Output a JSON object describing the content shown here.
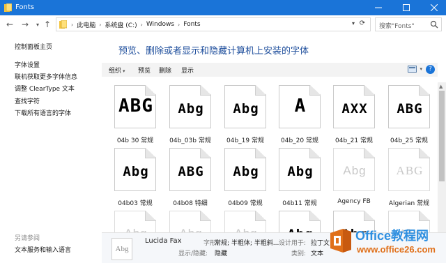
{
  "window": {
    "title": "Fonts",
    "colors": {
      "titlebar": "#1a74d8",
      "heading": "#1e4e9c",
      "toolbar": "#f3f3f3"
    }
  },
  "address": {
    "crumbs": [
      "此电脑",
      "系统盘 (C:)",
      "Windows",
      "Fonts"
    ],
    "search_placeholder": "搜索\"Fonts\""
  },
  "sidebar": {
    "top_link": "控制面板主页",
    "links": [
      "字体设置",
      "联机获取更多字体信息",
      "调整 ClearType 文本",
      "查找字符",
      "下载所有语言的字体"
    ],
    "see_also_heading": "另请参阅",
    "see_also_links": [
      "文本服务和输入语言"
    ]
  },
  "main": {
    "heading": "预览、删除或者显示和隐藏计算机上安装的字体",
    "toolbar": {
      "organize": "组织",
      "preview": "预览",
      "delete": "删除",
      "show": "显示"
    }
  },
  "fonts": [
    {
      "sample": "ABG",
      "label": "04b 30 常规",
      "style": "big"
    },
    {
      "sample": "Abg",
      "label": "04b_03b 常规",
      "style": "pixel"
    },
    {
      "sample": "Abg",
      "label": "04b_19 常规",
      "style": "pixel"
    },
    {
      "sample": "A",
      "label": "04b_20 常规",
      "style": "big"
    },
    {
      "sample": "AXX",
      "label": "04b_21 常规",
      "style": "pixel"
    },
    {
      "sample": "ABG",
      "label": "04b_25 常规",
      "style": "pixel"
    },
    {
      "sample": "Abg",
      "label": "04b03 常规",
      "style": "pixel"
    },
    {
      "sample": "ABG",
      "label": "04b08 特细",
      "style": "pixel"
    },
    {
      "sample": "Abg",
      "label": "04b09 常规",
      "style": "pixel"
    },
    {
      "sample": "Abg",
      "label": "04b11 常规",
      "style": "pixel"
    },
    {
      "sample": "Abg",
      "label": "Agency FB",
      "style": "light"
    },
    {
      "sample": "ABG",
      "label": "Algerian 常规",
      "style": "serif-light"
    },
    {
      "sample": "Abg",
      "label": "",
      "style": "light"
    },
    {
      "sample": "Abg",
      "label": "",
      "style": "light"
    },
    {
      "sample": "Abg",
      "label": "",
      "style": "light"
    },
    {
      "sample": "Abg",
      "label": "",
      "style": "pixel"
    },
    {
      "sample": "Abg",
      "label": "",
      "style": "pixel"
    },
    {
      "sample": "Abg",
      "label": "",
      "style": "serif-light"
    }
  ],
  "details": {
    "thumb_sample": "Abg",
    "name": "Lucida Fax",
    "style_key": "字形:",
    "style_value": "常规; 半粗体; 半粗斜...",
    "visibility_key": "显示/隐藏:",
    "visibility_value": "隐藏",
    "designed_for_key": "设计用于:",
    "designed_for_value": "拉丁文",
    "category_key": "类别:",
    "category_value": "文本"
  },
  "watermark": {
    "brand": "Office教程网",
    "url": "www.office26.com"
  }
}
